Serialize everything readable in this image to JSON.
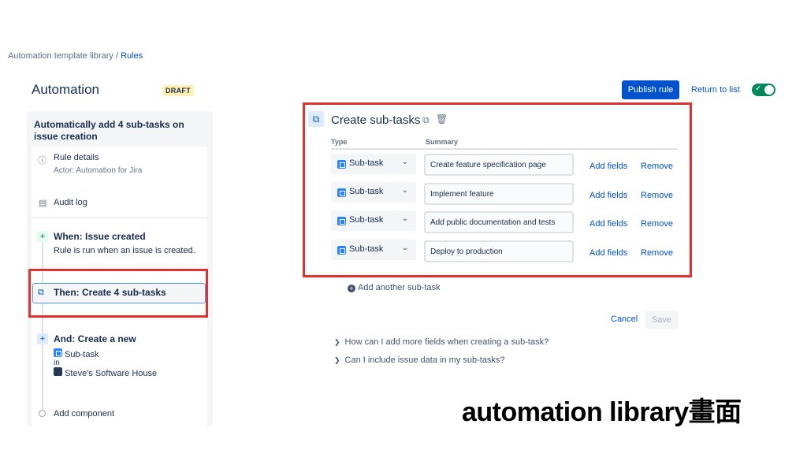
{
  "breadcrumb": {
    "parent": "Automation template library",
    "separator": "/",
    "current": "Rules"
  },
  "header": {
    "title": "Automation",
    "badge": "DRAFT",
    "publish_label": "Publish rule",
    "return_label": "Return to list",
    "toggle_on": true,
    "toggle_check": "✓"
  },
  "rule": {
    "title": "Automatically add 4 sub-tasks on issue creation",
    "details_label": "Rule details",
    "actor": "Actor: Automation for Jira",
    "audit_label": "Audit log",
    "trigger_title": "When: Issue created",
    "trigger_desc": "Rule is run when an issue is created.",
    "then_title": "Then: Create 4 sub-tasks",
    "and_title": "And: Create a new",
    "and_type": "Sub-task",
    "and_in": "in",
    "and_project": "Steve's Software House",
    "add_component": "Add component",
    "plus": "+"
  },
  "main": {
    "title": "Create sub-tasks",
    "col_type": "Type",
    "col_summary": "Summary",
    "rows": [
      {
        "type": "Sub-task",
        "summary": "Create feature specification page",
        "add_fields": "Add fields",
        "remove": "Remove"
      },
      {
        "type": "Sub-task",
        "summary": "Implement feature",
        "add_fields": "Add fields",
        "remove": "Remove"
      },
      {
        "type": "Sub-task",
        "summary": "Add public documentation and tests",
        "add_fields": "Add fields",
        "remove": "Remove"
      },
      {
        "type": "Sub-task",
        "summary": "Deploy to production",
        "add_fields": "Add fields",
        "remove": "Remove"
      }
    ],
    "add_another": "Add another sub-task",
    "cancel_label": "Cancel",
    "save_label": "Save",
    "faq": [
      "How can I add more fields when creating a sub-task?",
      "Can I include issue data in my sub-tasks?"
    ]
  },
  "overlay_caption": "automation library畫面",
  "colors": {
    "accent": "#0052cc",
    "highlight": "#e03131",
    "toggle": "#00875a"
  }
}
